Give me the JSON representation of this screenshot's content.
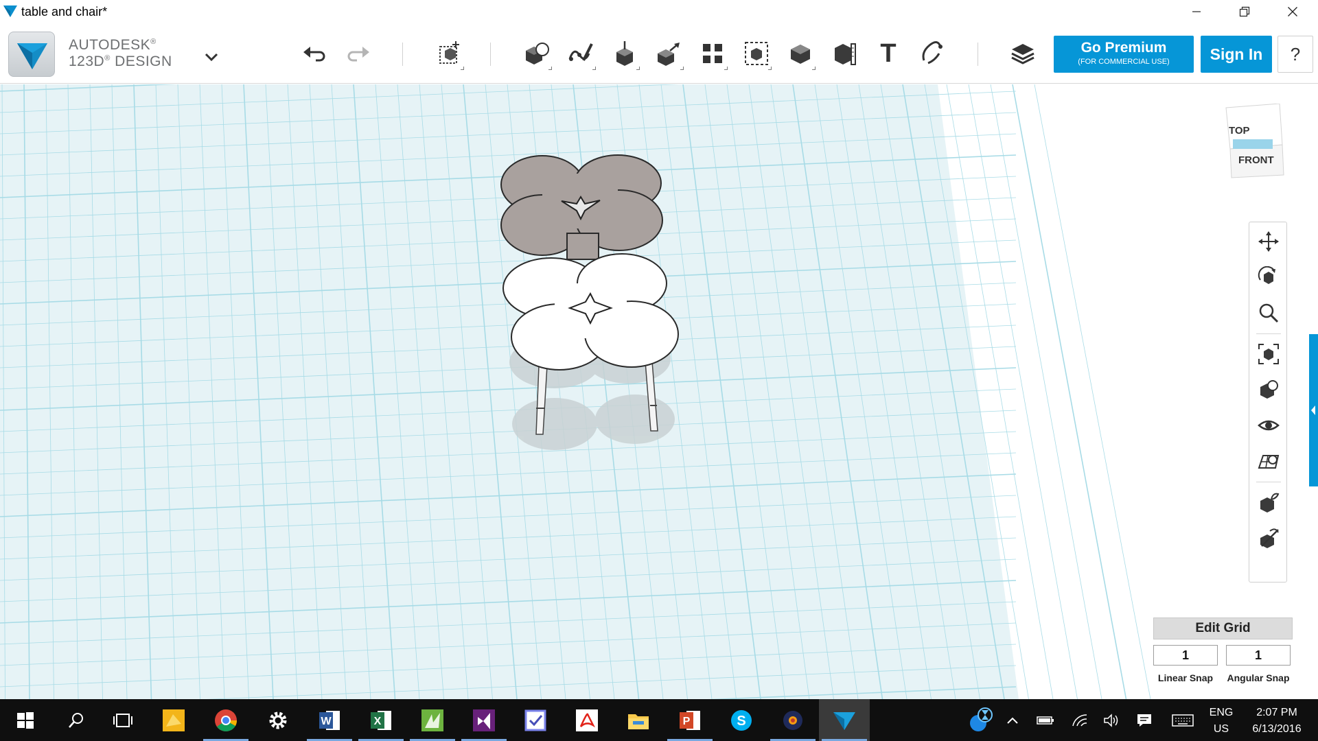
{
  "window": {
    "title": "table and chair*",
    "minimize_icon": "minimize-icon",
    "restore_icon": "restore-icon",
    "close_icon": "close-icon"
  },
  "brand": {
    "line1": "AUTODESK",
    "line1_mark": "®",
    "line2": "123D",
    "line2_mark": "®",
    "line2_rest": " DESIGN",
    "accent_color": "#0696d7"
  },
  "toolbar": {
    "tools": [
      {
        "name": "undo",
        "icon": "undo-icon"
      },
      {
        "name": "redo",
        "icon": "redo-icon"
      },
      {
        "name": "transform",
        "icon": "transform-icon"
      },
      {
        "name": "primitives",
        "icon": "primitives-icon"
      },
      {
        "name": "sketch",
        "icon": "sketch-icon"
      },
      {
        "name": "construct",
        "icon": "construct-icon"
      },
      {
        "name": "modify",
        "icon": "modify-icon"
      },
      {
        "name": "pattern",
        "icon": "pattern-icon"
      },
      {
        "name": "grouping",
        "icon": "grouping-icon"
      },
      {
        "name": "combine",
        "icon": "combine-icon"
      },
      {
        "name": "measure",
        "icon": "measure-icon"
      },
      {
        "name": "text",
        "icon": "text-icon",
        "glyph": "T"
      },
      {
        "name": "snap",
        "icon": "snap-icon"
      },
      {
        "name": "materials",
        "icon": "materials-icon"
      }
    ],
    "premium_label": "Go Premium",
    "premium_sub": "(FOR COMMERCIAL USE)",
    "signin_label": "Sign In",
    "help_label": "?"
  },
  "viewcube": {
    "top_label": "TOP",
    "front_label": "FRONT"
  },
  "nav_tools": [
    {
      "name": "pan",
      "icon": "pan-icon"
    },
    {
      "name": "orbit",
      "icon": "orbit-icon"
    },
    {
      "name": "zoom",
      "icon": "zoom-icon"
    },
    {
      "name": "fit",
      "icon": "fit-to-view-icon"
    },
    {
      "name": "views",
      "icon": "views-icon"
    },
    {
      "name": "visibility",
      "icon": "eye-icon"
    },
    {
      "name": "grid-display",
      "icon": "grid-display-icon"
    },
    {
      "name": "material-view",
      "icon": "material-view-icon"
    },
    {
      "name": "snap-settings",
      "icon": "snap-settings-icon"
    }
  ],
  "grid": {
    "edit_label": "Edit Grid",
    "linear_snap_value": "1",
    "angular_snap_value": "1",
    "linear_snap_label": "Linear Snap",
    "angular_snap_label": "Angular Snap"
  },
  "taskbar": {
    "apps": [
      {
        "name": "start",
        "icon": "windows-start-icon"
      },
      {
        "name": "search",
        "icon": "search-icon"
      },
      {
        "name": "task-view",
        "icon": "task-view-icon"
      },
      {
        "name": "sticky",
        "icon": "yellow-app-icon"
      },
      {
        "name": "chrome",
        "icon": "chrome-icon"
      },
      {
        "name": "settings",
        "icon": "settings-gear-icon"
      },
      {
        "name": "word",
        "icon": "word-icon"
      },
      {
        "name": "excel",
        "icon": "excel-icon"
      },
      {
        "name": "green-app",
        "icon": "green-app-icon"
      },
      {
        "name": "visual-studio",
        "icon": "visual-studio-icon"
      },
      {
        "name": "check-app",
        "icon": "checklist-icon"
      },
      {
        "name": "acrobat",
        "icon": "acrobat-icon"
      },
      {
        "name": "file-explorer",
        "icon": "folder-icon"
      },
      {
        "name": "powerpoint",
        "icon": "powerpoint-icon"
      },
      {
        "name": "skype",
        "icon": "skype-icon"
      },
      {
        "name": "dark-app",
        "icon": "dark-app-icon"
      },
      {
        "name": "123d-design",
        "icon": "123d-design-icon"
      }
    ],
    "tray": {
      "language_line1": "ENG",
      "language_line2": "US",
      "time": "2:07 PM",
      "date": "6/13/2016"
    }
  }
}
